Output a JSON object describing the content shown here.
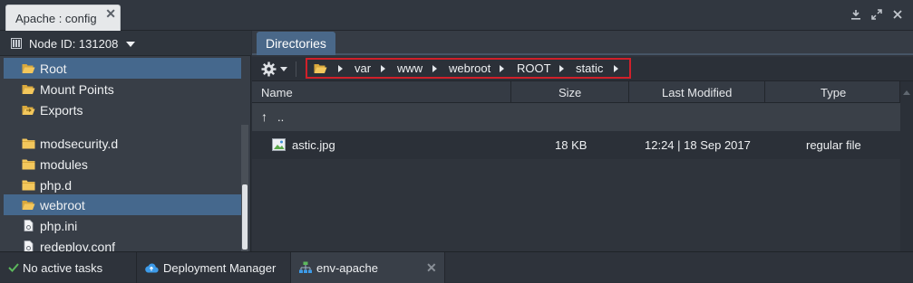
{
  "window": {
    "tab_title": "Apache : config",
    "close_glyph": "✕",
    "controls": [
      "download-icon",
      "maximize-icon",
      "close-icon"
    ]
  },
  "node": {
    "label": "Node ID: 131208"
  },
  "tree": {
    "items": [
      {
        "label": "Root",
        "icon": "folder-open-icon",
        "selected": true
      },
      {
        "label": "Mount Points",
        "icon": "folder-open-icon",
        "selected": false
      },
      {
        "label": "Exports",
        "icon": "folder-share-icon",
        "selected": false
      },
      {
        "label": "modsecurity.d",
        "icon": "folder-icon",
        "selected": false
      },
      {
        "label": "modules",
        "icon": "folder-icon",
        "selected": false
      },
      {
        "label": "php.d",
        "icon": "folder-icon",
        "selected": false
      },
      {
        "label": "webroot",
        "icon": "folder-open-icon",
        "selected": true
      },
      {
        "label": "php.ini",
        "icon": "config-file-icon",
        "selected": false
      },
      {
        "label": "redeploy.conf",
        "icon": "config-file-icon",
        "selected": false
      }
    ]
  },
  "directories": {
    "tab_label": "Directories",
    "breadcrumb": [
      "var",
      "www",
      "webroot",
      "ROOT",
      "static"
    ],
    "columns": {
      "name": "Name",
      "size": "Size",
      "modified": "Last Modified",
      "type": "Type"
    },
    "parent_row": {
      "symbol": "↑",
      "label": ".."
    },
    "files": [
      {
        "name": "astic.jpg",
        "size": "18 KB",
        "modified": "12:24 | 18 Sep 2017",
        "type": "regular file",
        "icon": "image-file-icon"
      }
    ]
  },
  "statusbar": {
    "tasks": "No active tasks",
    "deployment_manager": "Deployment Manager",
    "env": "env-apache",
    "close_glyph": "✕"
  },
  "colors": {
    "accent": "#4a6889",
    "selection": "#45688d",
    "highlight_border": "#d0202a",
    "folder": "#f0c35a",
    "ok_check": "#5cb85c",
    "cloud": "#3d9be9"
  }
}
